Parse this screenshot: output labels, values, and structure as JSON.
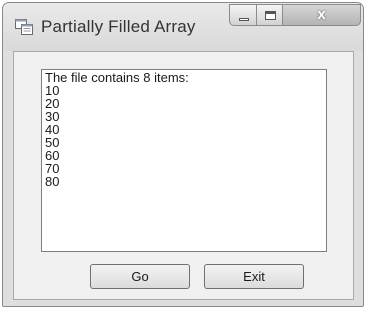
{
  "window": {
    "title": "Partially Filled Array",
    "close_symbol": "x"
  },
  "icons": {
    "app": "form-window-icon",
    "minimize": "minimize-icon",
    "maximize": "maximize-icon",
    "close": "close-icon"
  },
  "listbox": {
    "items": [
      "The file contains 8 items:",
      "10",
      "20",
      "30",
      "40",
      "50",
      "60",
      "70",
      "80"
    ]
  },
  "buttons": {
    "go_label": "Go",
    "exit_label": "Exit"
  }
}
